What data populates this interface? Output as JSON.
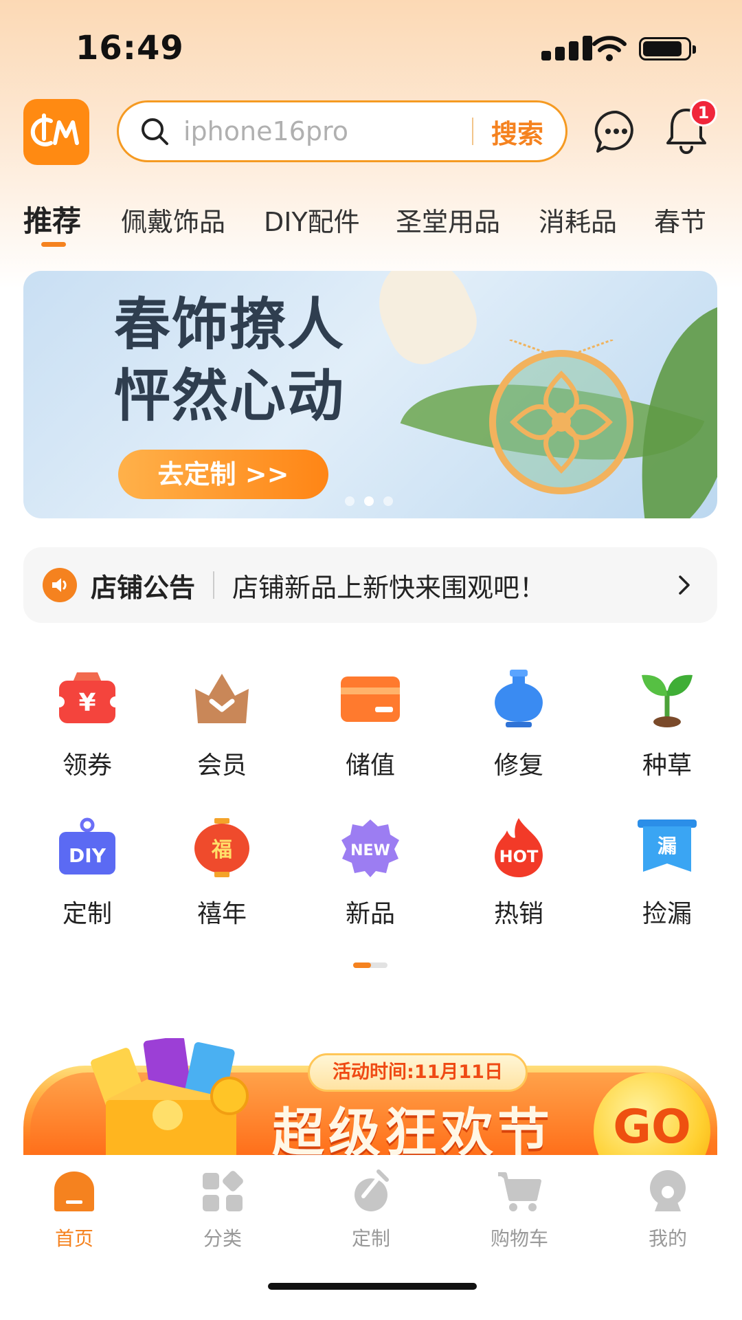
{
  "status_bar": {
    "time": "16:49"
  },
  "header": {
    "search_placeholder": "iphone16pro",
    "search_button": "搜索",
    "notification_count": "1"
  },
  "tabs": [
    "推荐",
    "佩戴饰品",
    "DIY配件",
    "圣堂用品",
    "消耗品",
    "春节"
  ],
  "banner": {
    "headline_line1": "春饰撩人",
    "headline_line2": "怦然心动",
    "cta": "去定制 >>"
  },
  "notice": {
    "title": "店铺公告",
    "text": "店铺新品上新快来围观吧！"
  },
  "grid": [
    {
      "label": "领券",
      "icon": "coupon-icon"
    },
    {
      "label": "会员",
      "icon": "crown-icon"
    },
    {
      "label": "储值",
      "icon": "card-icon"
    },
    {
      "label": "修复",
      "icon": "vase-icon"
    },
    {
      "label": "种草",
      "icon": "sprout-icon"
    },
    {
      "label": "定制",
      "icon": "diy-tag-icon"
    },
    {
      "label": "禧年",
      "icon": "lantern-icon"
    },
    {
      "label": "新品",
      "icon": "new-badge-icon"
    },
    {
      "label": "热销",
      "icon": "hot-flame-icon"
    },
    {
      "label": "捡漏",
      "icon": "bargain-banner-icon"
    }
  ],
  "grid_icon_text": {
    "diy": "DIY",
    "fu": "福",
    "new": "NEW",
    "hot": "HOT",
    "lou": "漏",
    "yuan": "¥"
  },
  "promo": {
    "date": "活动时间:11月11日",
    "title": "超级狂欢节",
    "go": "GO"
  },
  "tabbar": [
    {
      "label": "首页",
      "icon": "home-icon",
      "active": true
    },
    {
      "label": "分类",
      "icon": "category-icon",
      "active": false
    },
    {
      "label": "定制",
      "icon": "custom-icon",
      "active": false
    },
    {
      "label": "购物车",
      "icon": "cart-icon",
      "active": false
    },
    {
      "label": "我的",
      "icon": "profile-icon",
      "active": false
    }
  ],
  "colors": {
    "accent": "#f5821f",
    "badge": "#f0263b",
    "inactive": "#999999"
  }
}
